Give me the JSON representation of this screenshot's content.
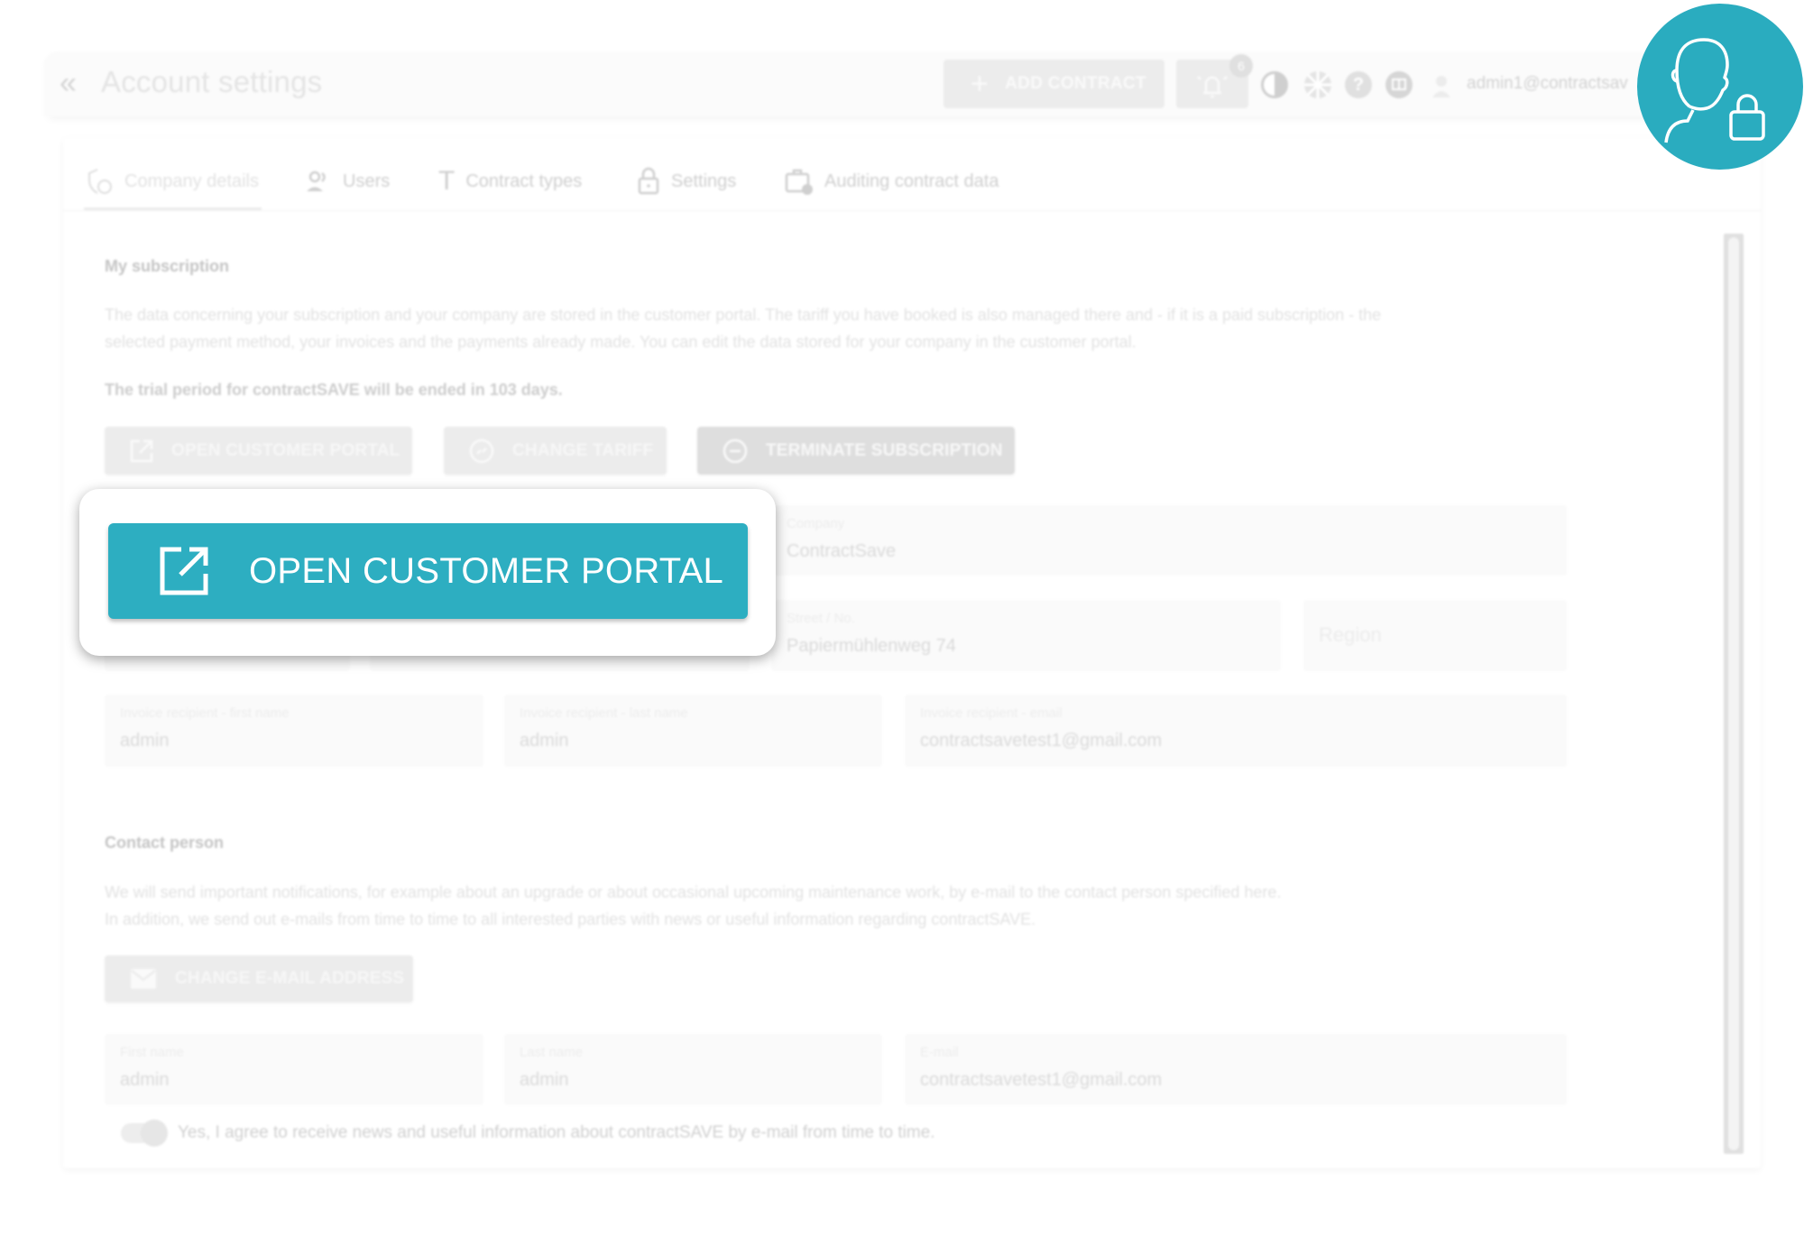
{
  "header": {
    "back_icon": "double-chevron-left-icon",
    "title": "Account settings",
    "add_contract_label": "ADD CONTRACT",
    "notification_count": "6",
    "user_email": "admin1@contractsav"
  },
  "tabs": [
    {
      "label": "Company details",
      "icon": "shield-icon",
      "active": true
    },
    {
      "label": "Users",
      "icon": "users-icon",
      "active": false
    },
    {
      "label": "Contract types",
      "icon": "text-t-icon",
      "active": false
    },
    {
      "label": "Settings",
      "icon": "lock-icon",
      "active": false
    },
    {
      "label": "Auditing contract data",
      "icon": "briefcase-clock-icon",
      "active": false
    }
  ],
  "subscription": {
    "title": "My subscription",
    "description_line1": "The data concerning your subscription and your company are stored in the customer portal. The tariff you have booked is also managed there and - if it is a paid subscription - the",
    "description_line2": "selected payment method, your invoices and the payments already made. You can edit the data stored for your company in the customer portal.",
    "trial_notice": "The trial period for contractSAVE will be ended in 103 days.",
    "buttons": {
      "open_portal": "OPEN CUSTOMER PORTAL",
      "change_tariff": "CHANGE TARIFF",
      "terminate": "TERMINATE SUBSCRIPTION"
    }
  },
  "company_fields": {
    "company": {
      "label": "Company",
      "value": "ContractSave"
    },
    "street": {
      "label": "Street / No.",
      "value": "Papiermühlenweg 74"
    },
    "region": {
      "placeholder": "Region"
    },
    "invoice_first_name": {
      "label": "Invoice recipient - first name",
      "value": "admin"
    },
    "invoice_last_name": {
      "label": "Invoice recipient - last name",
      "value": "admin"
    },
    "invoice_email": {
      "label": "Invoice recipient - email",
      "value": "contractsavetest1@gmail.com"
    }
  },
  "contact": {
    "title": "Contact person",
    "description_line1": "We will send important notifications, for example about an upgrade or about occasional upcoming maintenance work, by e-mail to the contact person specified here.",
    "description_line2": "In addition, we send out e-mails from time to time to all interested parties with news or useful information regarding contractSAVE.",
    "change_email_label": "CHANGE E-MAIL ADDRESS",
    "first_name": {
      "label": "First name",
      "value": "admin"
    },
    "last_name": {
      "label": "Last name",
      "value": "admin"
    },
    "email": {
      "label": "E-mail",
      "value": "contractsavetest1@gmail.com"
    },
    "newsletter_toggle_label": "Yes, I agree to receive news and useful information about contractSAVE by e-mail from time to time.",
    "newsletter_toggle_on": true
  },
  "callout": {
    "button_label": "OPEN CUSTOMER PORTAL",
    "button_icon": "external-link-icon",
    "badge_icon": "user-lock-icon"
  },
  "colors": {
    "accent": "#2daec1",
    "badge_circle": "#2aacbf"
  }
}
